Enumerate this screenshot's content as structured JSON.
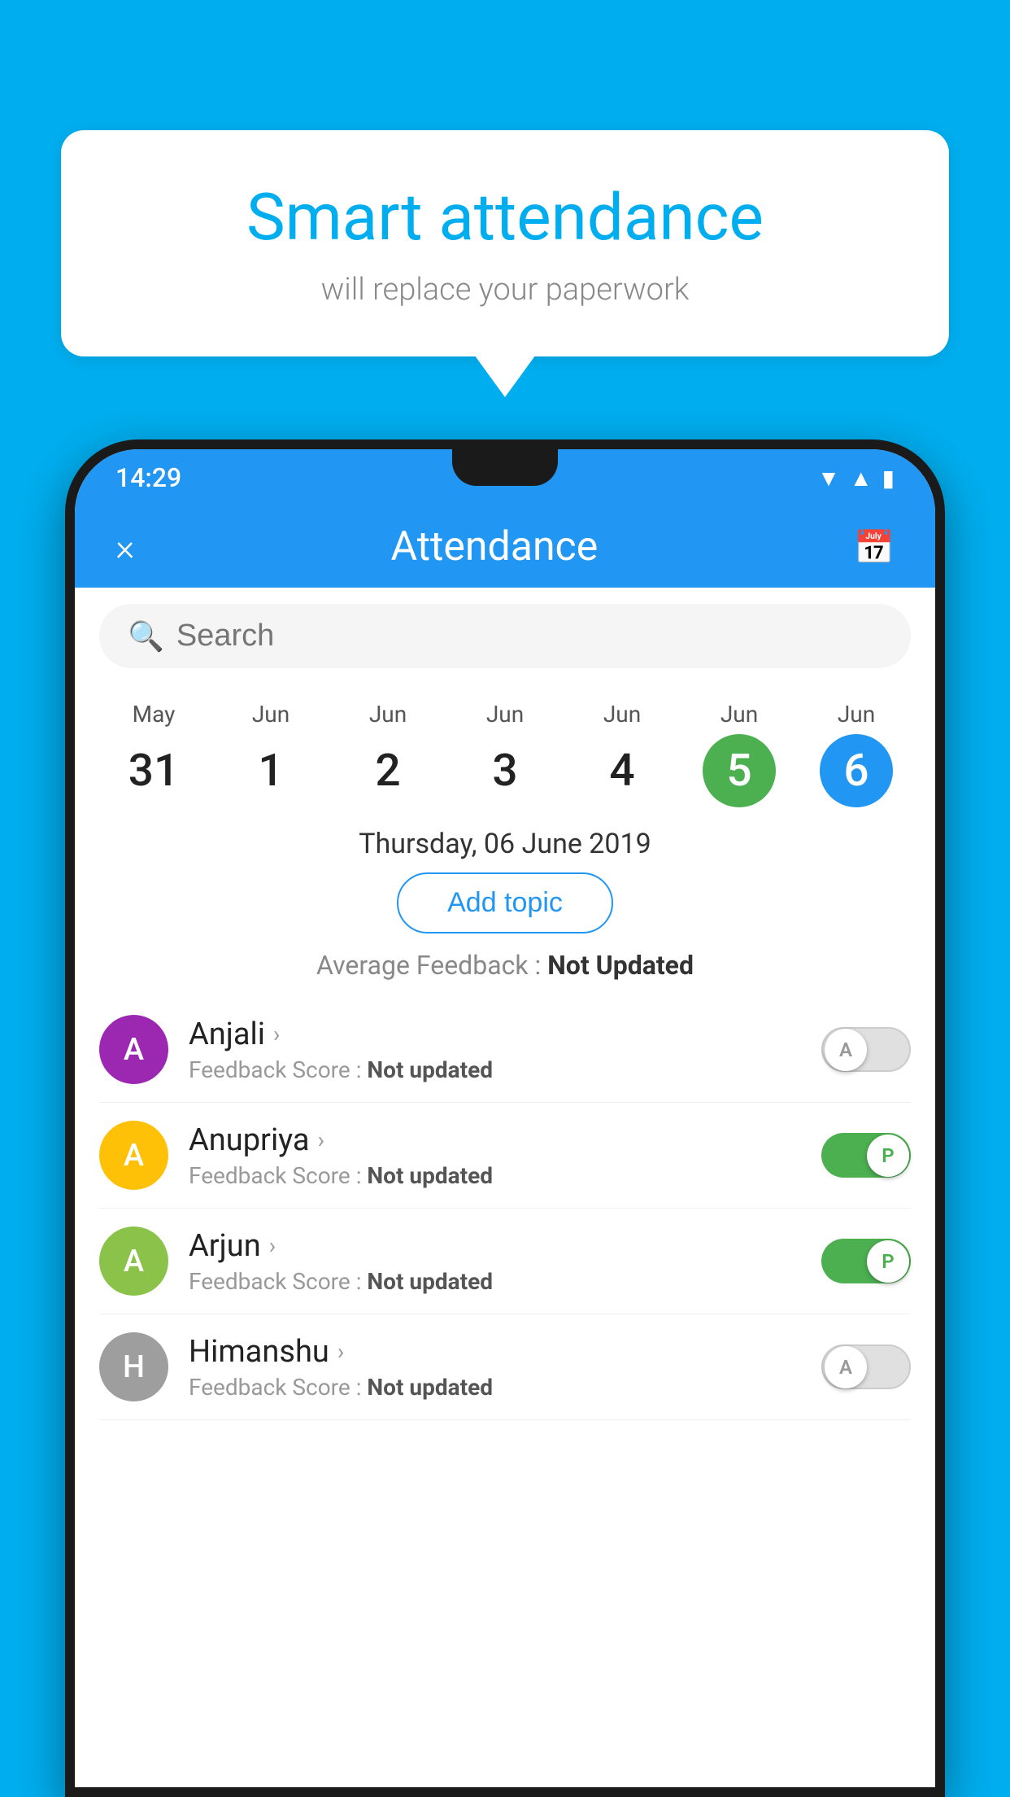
{
  "background_color": "#00AEEF",
  "speech_bubble": {
    "title": "Smart attendance",
    "subtitle": "will replace your paperwork"
  },
  "status_bar": {
    "time": "14:29",
    "icons": [
      "wifi",
      "signal",
      "battery"
    ]
  },
  "header": {
    "title": "Attendance",
    "close_label": "×",
    "calendar_icon": "📅"
  },
  "search": {
    "placeholder": "Search"
  },
  "dates": [
    {
      "month": "May",
      "day": "31",
      "state": "normal"
    },
    {
      "month": "Jun",
      "day": "1",
      "state": "normal"
    },
    {
      "month": "Jun",
      "day": "2",
      "state": "normal"
    },
    {
      "month": "Jun",
      "day": "3",
      "state": "normal"
    },
    {
      "month": "Jun",
      "day": "4",
      "state": "normal"
    },
    {
      "month": "Jun",
      "day": "5",
      "state": "green"
    },
    {
      "month": "Jun",
      "day": "6",
      "state": "blue"
    }
  ],
  "selected_date": "Thursday, 06 June 2019",
  "add_topic_label": "Add topic",
  "avg_feedback_label": "Average Feedback : ",
  "avg_feedback_value": "Not Updated",
  "students": [
    {
      "name": "Anjali",
      "avatar_letter": "A",
      "avatar_color": "#9C27B0",
      "feedback_label": "Feedback Score : ",
      "feedback_value": "Not updated",
      "toggle_state": "off",
      "toggle_label": "A"
    },
    {
      "name": "Anupriya",
      "avatar_letter": "A",
      "avatar_color": "#FFC107",
      "feedback_label": "Feedback Score : ",
      "feedback_value": "Not updated",
      "toggle_state": "on",
      "toggle_label": "P"
    },
    {
      "name": "Arjun",
      "avatar_letter": "A",
      "avatar_color": "#8BC34A",
      "feedback_label": "Feedback Score : ",
      "feedback_value": "Not updated",
      "toggle_state": "on",
      "toggle_label": "P"
    },
    {
      "name": "Himanshu",
      "avatar_letter": "H",
      "avatar_color": "#9E9E9E",
      "feedback_label": "Feedback Score : ",
      "feedback_value": "Not updated",
      "toggle_state": "off",
      "toggle_label": "A"
    }
  ]
}
